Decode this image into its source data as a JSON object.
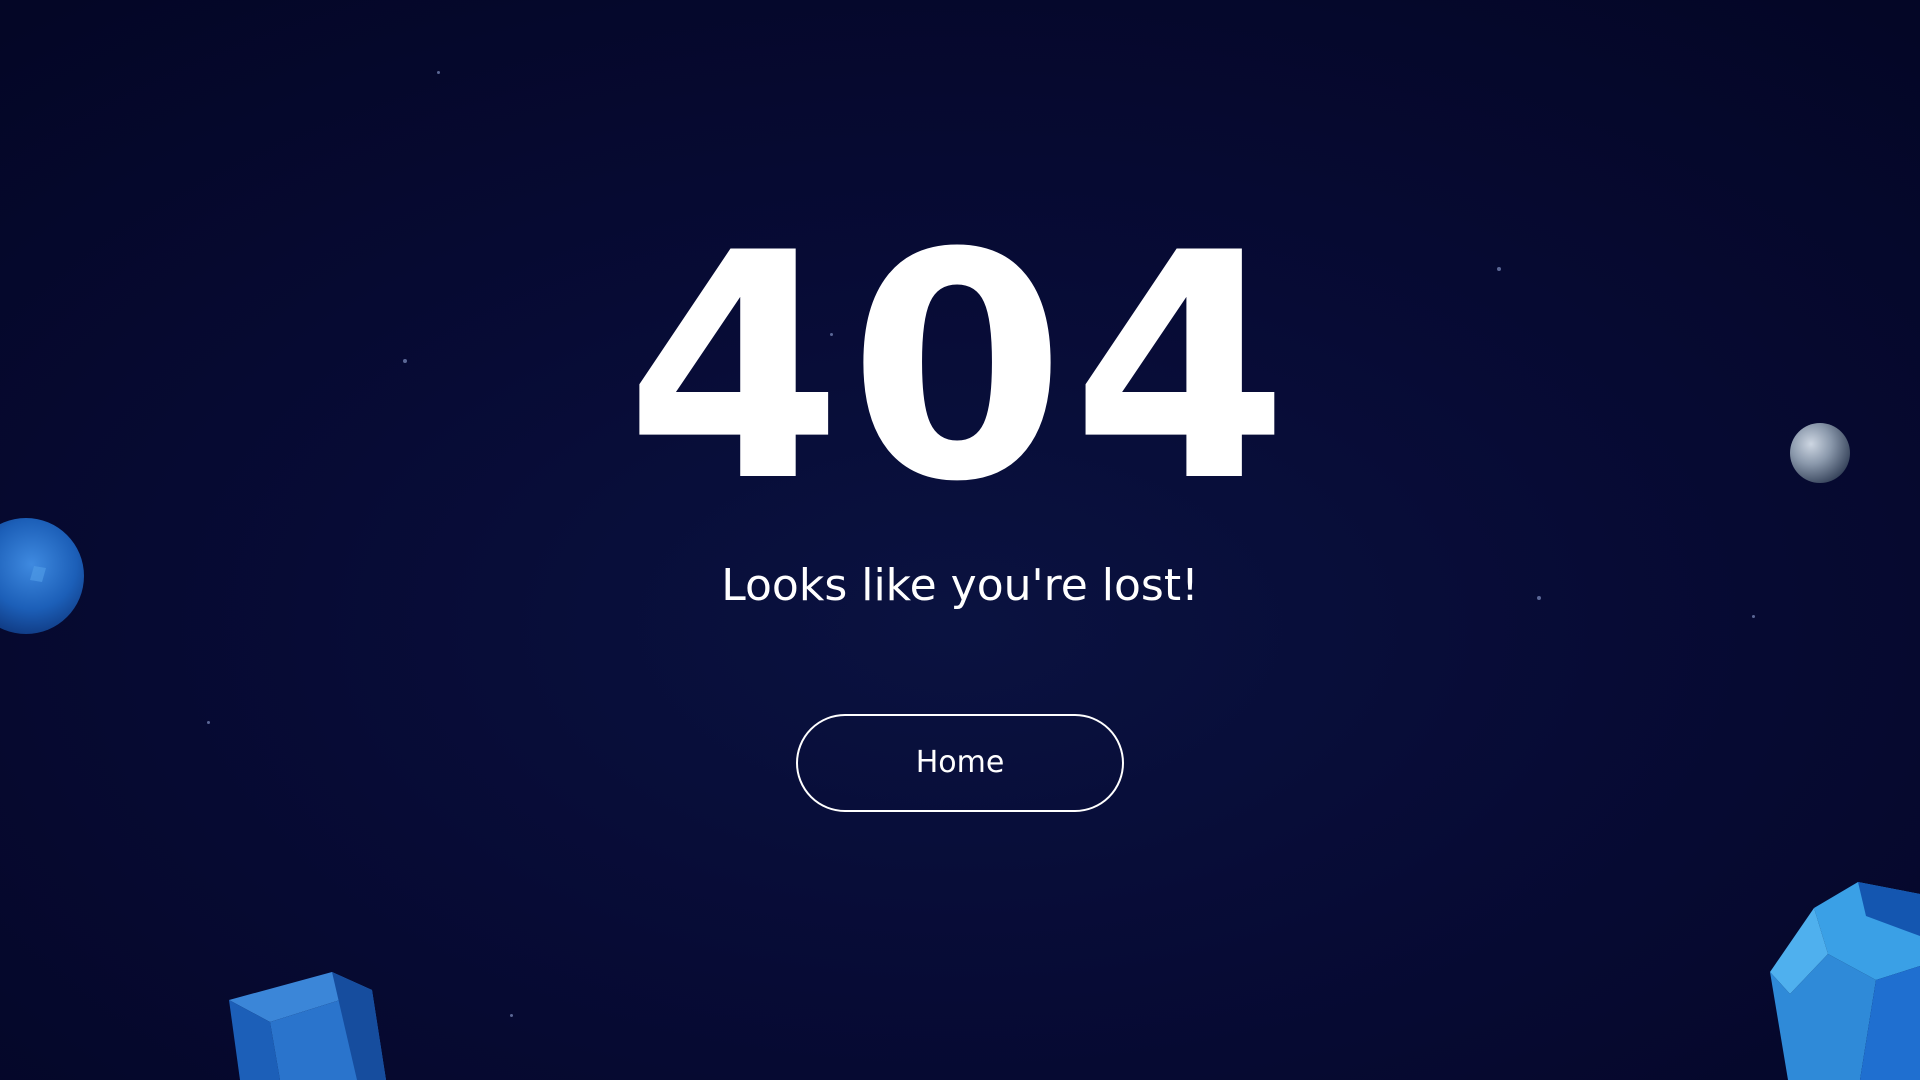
{
  "error_page": {
    "code": "404",
    "message": "Looks like you're lost!",
    "home_button_label": "Home"
  },
  "colors": {
    "background": "#070b35",
    "text": "#ffffff",
    "button_border": "#ffffff",
    "shape_blue": "#1f6fd0",
    "shape_light_blue": "#3a9ee6",
    "sphere_gray": "#9aa7b8"
  },
  "decorations": {
    "shapes": [
      "blue-sphere",
      "gray-sphere",
      "blue-cube",
      "blue-polyhedron"
    ]
  }
}
